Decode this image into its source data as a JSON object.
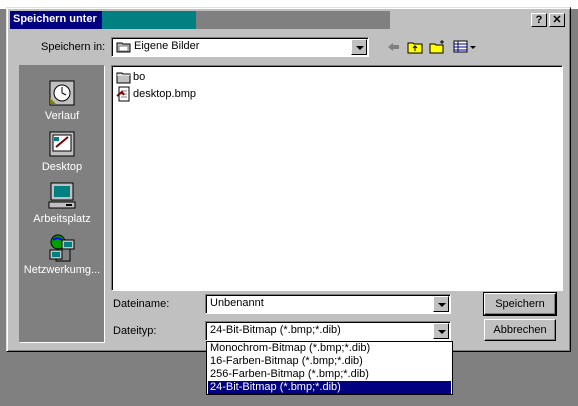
{
  "window": {
    "title": "Speichern unter",
    "help_button": "?",
    "close_button": "✕"
  },
  "save_in": {
    "label": "Speichern in:",
    "value": "Eigene Bilder"
  },
  "toolbar": {
    "back_icon": "back-arrow-icon",
    "up_icon": "up-folder-icon",
    "new_folder_icon": "new-folder-icon",
    "view_icon": "view-menu-icon"
  },
  "places": [
    {
      "label": "Verlauf",
      "icon": "history-icon"
    },
    {
      "label": "Desktop",
      "icon": "desktop-icon"
    },
    {
      "label": "Arbeitsplatz",
      "icon": "my-computer-icon"
    },
    {
      "label": "Netzwerkumg...",
      "icon": "network-icon"
    }
  ],
  "files": [
    {
      "name": "bo",
      "icon": "folder-icon"
    },
    {
      "name": "desktop.bmp",
      "icon": "bitmap-file-icon"
    }
  ],
  "filename": {
    "label": "Dateiname:",
    "value": "Unbenannt"
  },
  "filetype": {
    "label": "Dateityp:",
    "value": "24-Bit-Bitmap (*.bmp;*.dib)",
    "options": [
      "Monochrom-Bitmap (*.bmp;*.dib)",
      "16-Farben-Bitmap (*.bmp;*.dib)",
      "256-Farben-Bitmap (*.bmp;*.dib)",
      "24-Bit-Bitmap (*.bmp;*.dib)"
    ],
    "selected_index": 3
  },
  "buttons": {
    "save": "Speichern",
    "cancel": "Abbrechen"
  },
  "colors": {
    "title_active": "#000080",
    "title_teal": "#008080",
    "face": "#c0c0c0",
    "selection": "#000080"
  }
}
